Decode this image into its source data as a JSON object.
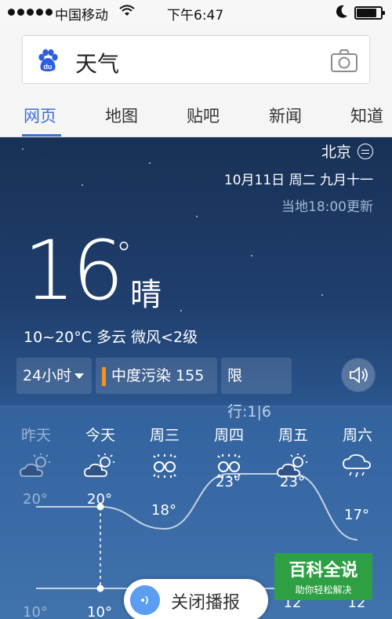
{
  "status_bar": {
    "carrier": "中国移动",
    "time": "下午6:47"
  },
  "search": {
    "query": "天气"
  },
  "tabs": [
    {
      "label": "网页",
      "active": true
    },
    {
      "label": "地图",
      "active": false
    },
    {
      "label": "贴吧",
      "active": false
    },
    {
      "label": "新闻",
      "active": false
    },
    {
      "label": "知道",
      "active": false
    }
  ],
  "weather": {
    "city": "北京",
    "date": "10月11日 周二 九月十一",
    "updated": "当地18:00更新",
    "current_temp": "16",
    "degree": "°",
    "condition": "晴",
    "summary": "10~20°C  多云 微风<2级",
    "chips": {
      "hours": "24小时",
      "air": "中度污染 155",
      "limit": "限行:1|6"
    },
    "days": [
      {
        "name": "昨天",
        "icon": "partly-cloudy-icon",
        "high": "20°",
        "low": "10°",
        "past": true
      },
      {
        "name": "今天",
        "icon": "partly-cloudy-icon",
        "high": "20°",
        "low": "10°",
        "past": false
      },
      {
        "name": "周三",
        "icon": "haze-icon",
        "high": "18°",
        "low": "",
        "past": false
      },
      {
        "name": "周四",
        "icon": "haze-icon",
        "high": "23°",
        "low": "",
        "past": false
      },
      {
        "name": "周五",
        "icon": "partly-cloudy-icon",
        "high": "23°",
        "low": "12",
        "past": false
      },
      {
        "name": "周六",
        "icon": "rain-icon",
        "high": "17°",
        "low": "12",
        "past": false
      }
    ],
    "high_values": [
      20,
      20,
      18,
      23,
      23,
      17
    ]
  },
  "broadcast": {
    "label": "关闭播报"
  },
  "watermark": {
    "title": "百科全说",
    "subtitle": "助你轻松解决"
  }
}
